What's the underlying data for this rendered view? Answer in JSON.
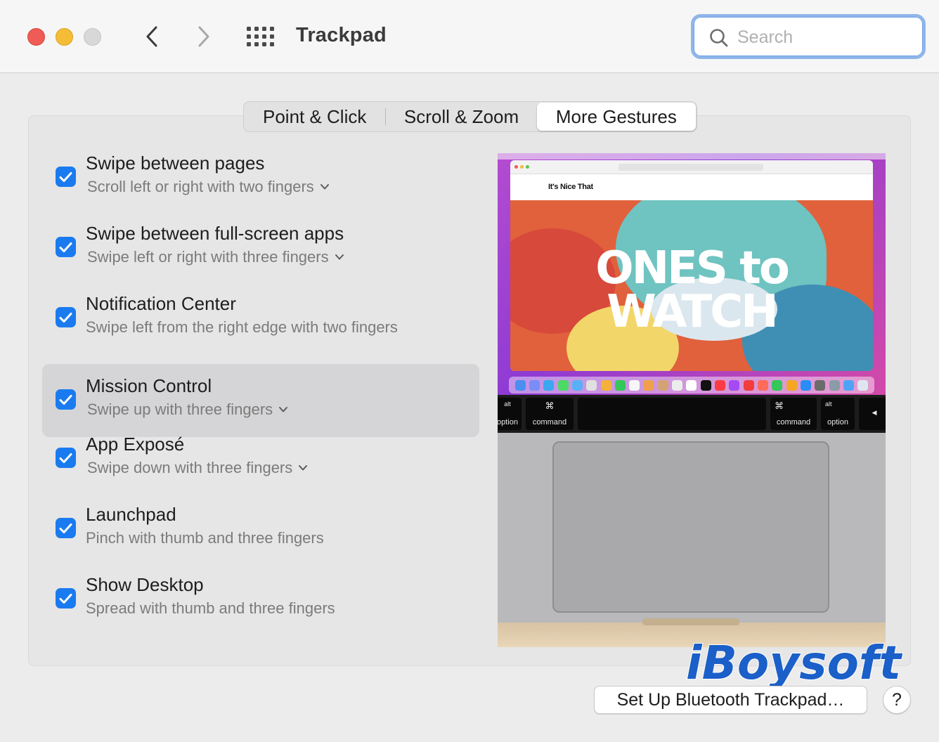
{
  "window": {
    "title": "Trackpad",
    "traffic_lights": {
      "close": "#ee5c55",
      "minimize": "#f5bd37",
      "zoom": "#d8d8d8"
    }
  },
  "toolbar": {
    "back_icon": "chevron-left-icon",
    "forward_icon": "chevron-right-icon",
    "show_all_icon": "grid-icon"
  },
  "search": {
    "placeholder": "Search",
    "value": ""
  },
  "tabs": [
    {
      "label": "Point & Click",
      "selected": false
    },
    {
      "label": "Scroll & Zoom",
      "selected": false
    },
    {
      "label": "More Gestures",
      "selected": true
    }
  ],
  "gestures": [
    {
      "title": "Swipe between pages",
      "subtitle": "Scroll left or right with two fingers",
      "checked": true,
      "has_dropdown": true,
      "selected": false
    },
    {
      "title": "Swipe between full-screen apps",
      "subtitle": "Swipe left or right with three fingers",
      "checked": true,
      "has_dropdown": true,
      "selected": false
    },
    {
      "title": "Notification Center",
      "subtitle": "Swipe left from the right edge with two fingers",
      "checked": true,
      "has_dropdown": false,
      "selected": false
    },
    {
      "title": "Mission Control",
      "subtitle": "Swipe up with three fingers",
      "checked": true,
      "has_dropdown": true,
      "selected": true
    },
    {
      "title": "App Exposé",
      "subtitle": "Swipe down with three fingers",
      "checked": true,
      "has_dropdown": true,
      "selected": false
    },
    {
      "title": "Launchpad",
      "subtitle": "Pinch with thumb and three fingers",
      "checked": true,
      "has_dropdown": false,
      "selected": false
    },
    {
      "title": "Show Desktop",
      "subtitle": "Spread with thumb and three fingers",
      "checked": true,
      "has_dropdown": false,
      "selected": false
    }
  ],
  "preview": {
    "site_logo": "It's Nice That",
    "hero_line1": "ONES to",
    "hero_line2": "WATCH",
    "keys": {
      "left_option_top": "alt",
      "left_option": "option",
      "left_command_symbol": "⌘",
      "left_command": "command",
      "right_command_symbol": "⌘",
      "right_command": "command",
      "right_option_top": "alt",
      "right_option": "option",
      "arrow": "◀"
    }
  },
  "watermark": "iBoysoft",
  "buttons": {
    "setup": "Set Up Bluetooth Trackpad…",
    "help": "?"
  },
  "colors": {
    "accent": "#1a7bf0",
    "search_focus_ring": "#8fb6ea",
    "watermark": "#1b5fc8"
  }
}
